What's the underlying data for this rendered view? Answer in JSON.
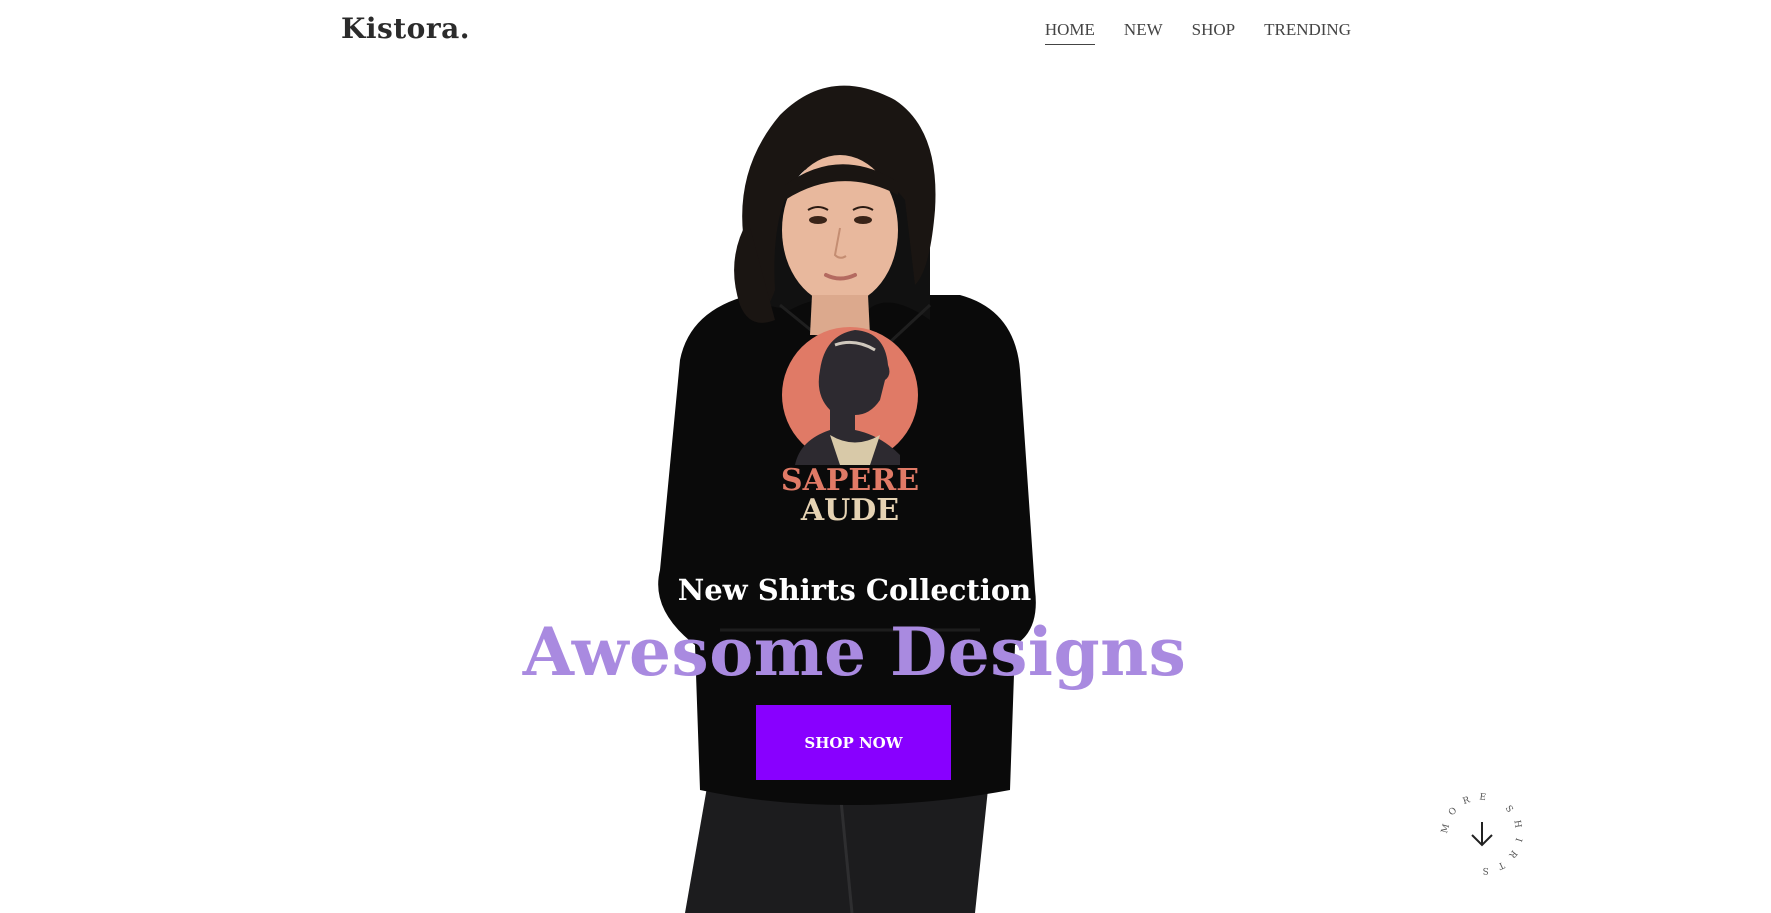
{
  "header": {
    "logo": "Kistora.",
    "nav": [
      {
        "label": "HOME",
        "active": true
      },
      {
        "label": "NEW",
        "active": false
      },
      {
        "label": "SHOP",
        "active": false
      },
      {
        "label": "TRENDING",
        "active": false
      }
    ]
  },
  "hero": {
    "image_alt": "woman in black hoodie",
    "print_text_line1": "SAPERE",
    "print_text_line2": "AUDE",
    "subtitle": "New Shirts Collection",
    "title": "Awesome Designs",
    "cta_label": "SHOP NOW"
  },
  "scroll_indicator": {
    "label": "MORE SHIRTS",
    "icon": "arrow-down-icon"
  },
  "colors": {
    "accent": "#8800ff",
    "title": "#a98ae0",
    "text": "#2b2b2b"
  }
}
